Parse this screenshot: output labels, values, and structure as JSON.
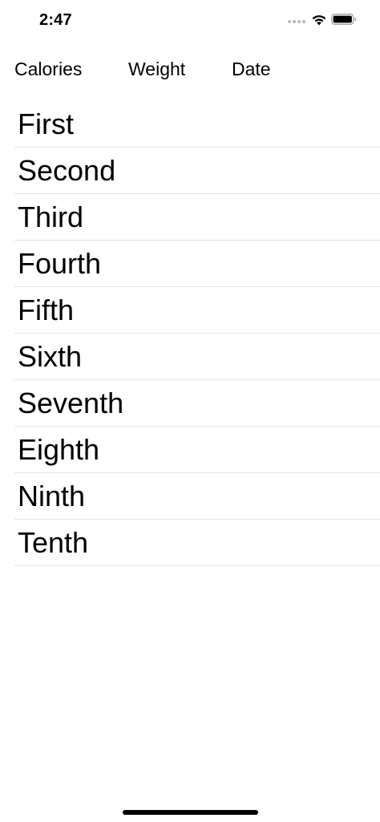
{
  "status_bar": {
    "time": "2:47",
    "icons": [
      "signal-dots-icon",
      "wifi-icon",
      "battery-icon"
    ]
  },
  "tabs": [
    {
      "label": "Calories"
    },
    {
      "label": "Weight"
    },
    {
      "label": "Date"
    }
  ],
  "list": {
    "items": [
      {
        "label": "First"
      },
      {
        "label": "Second"
      },
      {
        "label": "Third"
      },
      {
        "label": "Fourth"
      },
      {
        "label": "Fifth"
      },
      {
        "label": "Sixth"
      },
      {
        "label": "Seventh"
      },
      {
        "label": "Eighth"
      },
      {
        "label": "Ninth"
      },
      {
        "label": "Tenth"
      }
    ]
  },
  "colors": {
    "background": "#ffffff",
    "text": "#000000",
    "separator": "#e3e3e6"
  }
}
